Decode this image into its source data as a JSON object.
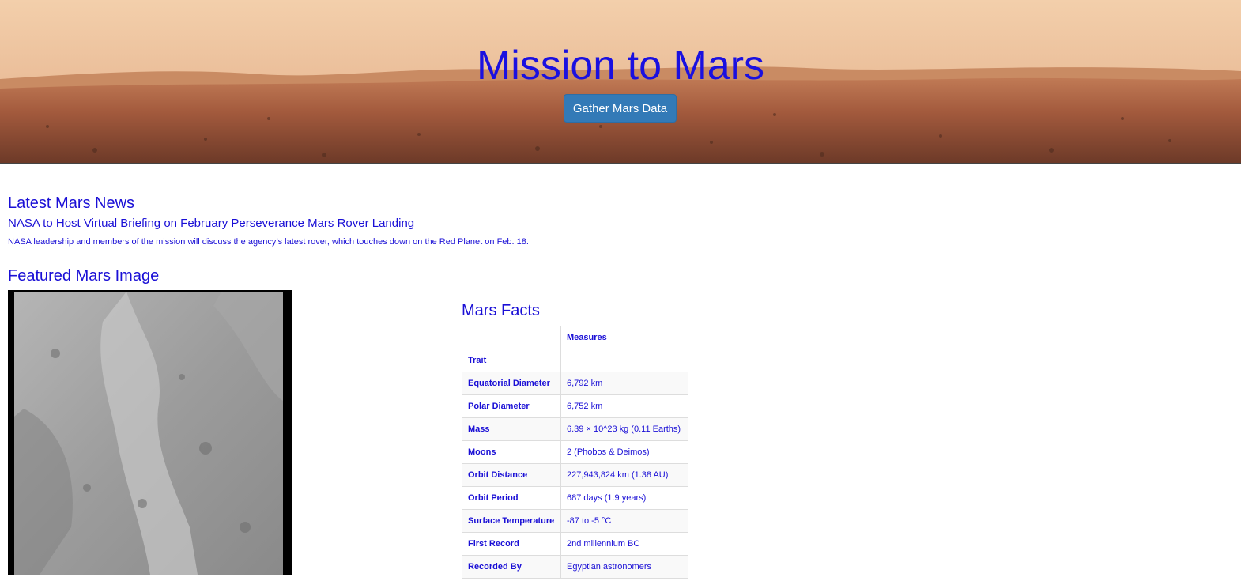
{
  "hero": {
    "title": "Mission to Mars",
    "button_label": "Gather Mars Data"
  },
  "news": {
    "heading": "Latest Mars News",
    "title": "NASA to Host Virtual Briefing on February Perseverance Mars Rover Landing",
    "paragraph": "NASA leadership and members of the mission will discuss the agency’s latest rover, which touches down on the Red Planet on Feb. 18."
  },
  "featured": {
    "heading": "Featured Mars Image"
  },
  "facts": {
    "heading": "Mars Facts",
    "header": [
      "",
      "Measures"
    ],
    "rows": [
      [
        "Trait",
        ""
      ],
      [
        "Equatorial Diameter",
        "6,792 km"
      ],
      [
        "Polar Diameter",
        "6,752 km"
      ],
      [
        "Mass",
        "6.39 × 10^23 kg (0.11 Earths)"
      ],
      [
        "Moons",
        "2 (Phobos & Deimos)"
      ],
      [
        "Orbit Distance",
        "227,943,824 km (1.38 AU)"
      ],
      [
        "Orbit Period",
        "687 days (1.9 years)"
      ],
      [
        "Surface Temperature",
        "-87 to -5 °C"
      ],
      [
        "First Record",
        "2nd millennium BC"
      ],
      [
        "Recorded By",
        "Egyptian astronomers"
      ]
    ]
  },
  "colors": {
    "text": "#1a0fd6",
    "button": "#337ab7"
  }
}
